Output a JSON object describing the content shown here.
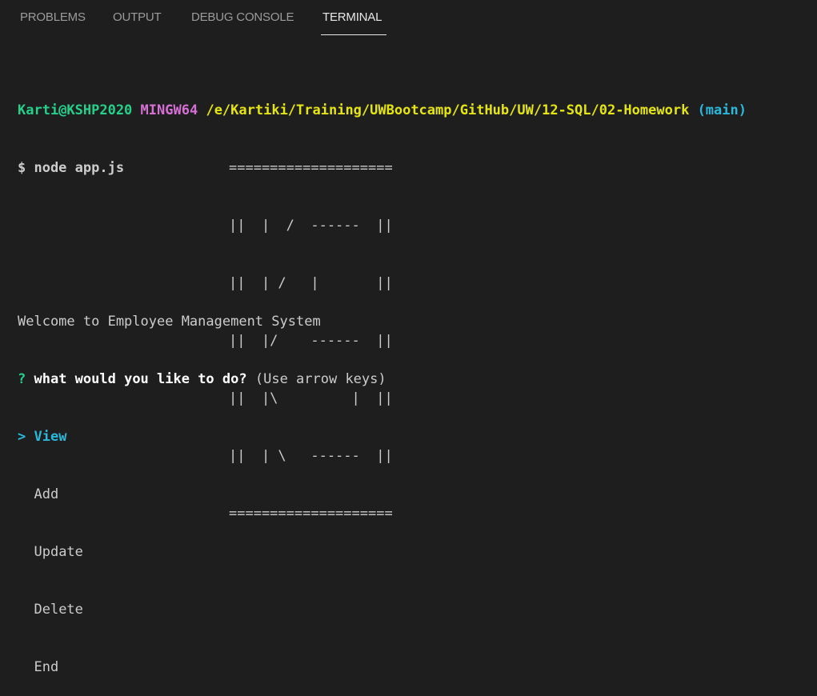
{
  "tabs": [
    {
      "label": "PROBLEMS"
    },
    {
      "label": "OUTPUT"
    },
    {
      "label": "DEBUG CONSOLE"
    },
    {
      "label": "TERMINAL"
    }
  ],
  "prompt": {
    "user_host": "Karti@KSHP2020",
    "env": "MINGW64",
    "path": "/e/Kartiki/Training/UWBootcamp/GitHub/UW/12-SQL/02-Homework",
    "branch": "(main)",
    "command": "$ node app.js"
  },
  "ascii_art": [
    "====================",
    "||  |  /  ------  ||",
    "||  | /   |       ||",
    "||  |/    ------  ||",
    "||  |\\         |  ||",
    "||  | \\   ------  ||",
    "===================="
  ],
  "welcome": "Welcome to Employee Management System",
  "question": {
    "mark": "?",
    "text": "what would you like to do?",
    "hint": "(Use arrow keys)"
  },
  "menu": {
    "pointer": ">",
    "items": [
      "View",
      "Add",
      "Update",
      "Delete",
      "End"
    ]
  },
  "colors": {
    "background": "#1e1e1e",
    "green": "#23d18b",
    "magenta": "#d670d6",
    "yellow": "#e5e510",
    "cyan": "#29b8db"
  }
}
